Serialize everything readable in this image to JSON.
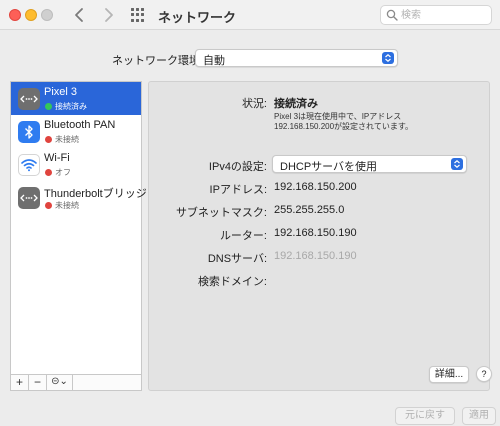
{
  "window": {
    "title": "ネットワーク"
  },
  "search": {
    "placeholder": "検索"
  },
  "location": {
    "label": "ネットワーク環境:",
    "value": "自動"
  },
  "services": [
    {
      "name": "Pixel 3",
      "status": "接続済み",
      "status_color": "#34c759",
      "icon": "ethernet-icon",
      "selected": true
    },
    {
      "name": "Bluetooth PAN",
      "status": "未接続",
      "status_color": "#e0443e",
      "icon": "bluetooth-icon",
      "selected": false
    },
    {
      "name": "Wi-Fi",
      "status": "オフ",
      "status_color": "#e0443e",
      "icon": "wifi-icon",
      "selected": false
    },
    {
      "name": "Thunderboltブリッジ",
      "status": "未接続",
      "status_color": "#e0443e",
      "icon": "ethernet-icon",
      "selected": false
    }
  ],
  "sidebar_tools": {
    "add": "+",
    "remove": "−",
    "more": "⊝⌄"
  },
  "detail": {
    "status_label": "状況:",
    "status_value": "接続済み",
    "status_desc_line1": "Pixel 3は現在使用中で、IPアドレス",
    "status_desc_line2": "192.168.150.200が設定されています。",
    "ipv4_label": "IPv4の設定:",
    "ipv4_value": "DHCPサーバを使用",
    "ip_label": "IPアドレス:",
    "ip_value": "192.168.150.200",
    "subnet_label": "サブネットマスク:",
    "subnet_value": "255.255.255.0",
    "router_label": "ルーター:",
    "router_value": "192.168.150.190",
    "dns_label": "DNSサーバ:",
    "dns_value": "192.168.150.190",
    "domain_label": "検索ドメイン:",
    "domain_value": "",
    "advanced_label": "詳細...",
    "help_label": "?"
  },
  "footer": {
    "revert_label": "元に戻す",
    "apply_label": "適用"
  },
  "colors": {
    "accent": "#2a66d9",
    "connected": "#34c759",
    "disconnected": "#e0443e"
  }
}
